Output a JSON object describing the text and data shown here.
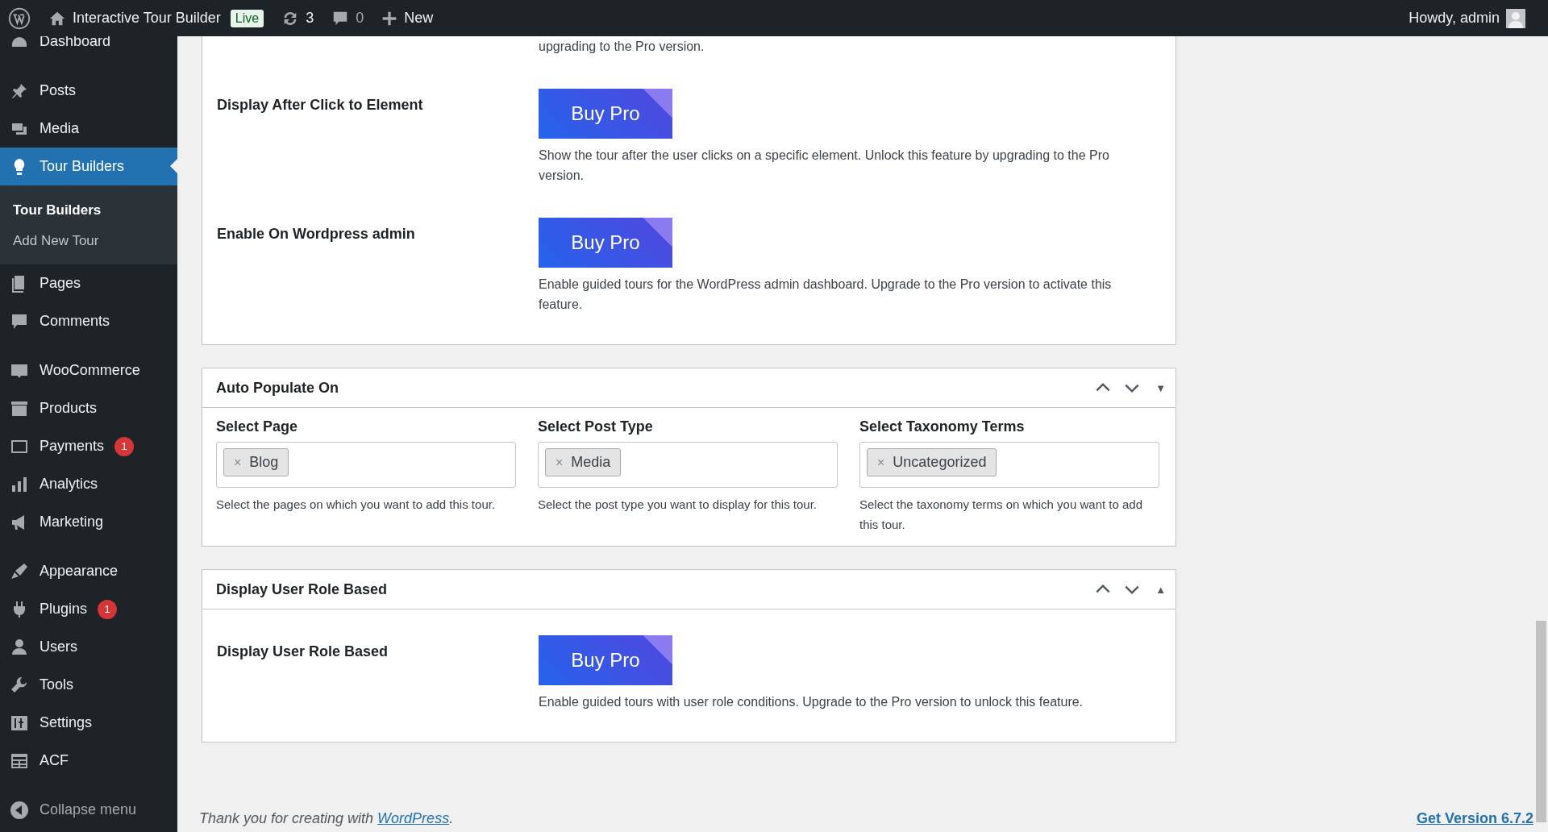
{
  "admin_bar": {
    "site_name": "Interactive Tour Builder",
    "live_badge": "Live",
    "updates_count": "3",
    "comments_count": "0",
    "new_label": "New",
    "greeting": "Howdy, admin"
  },
  "sidebar": {
    "groups": [
      {
        "items": [
          {
            "label": "Dashboard",
            "selected": false
          }
        ]
      },
      {
        "items": [
          {
            "label": "Posts",
            "selected": false
          },
          {
            "label": "Media",
            "selected": false
          },
          {
            "label": "Tour Builders",
            "selected": true,
            "children": [
              {
                "label": "Tour Builders",
                "selected": true
              },
              {
                "label": "Add New Tour",
                "selected": false
              }
            ]
          },
          {
            "label": "Pages",
            "selected": false
          },
          {
            "label": "Comments",
            "selected": false
          }
        ]
      },
      {
        "items": [
          {
            "label": "WooCommerce",
            "selected": false
          },
          {
            "label": "Products",
            "selected": false
          },
          {
            "label": "Payments",
            "selected": false,
            "badge": "1"
          },
          {
            "label": "Analytics",
            "selected": false
          },
          {
            "label": "Marketing",
            "selected": false
          }
        ]
      },
      {
        "items": [
          {
            "label": "Appearance",
            "selected": false
          },
          {
            "label": "Plugins",
            "selected": false,
            "badge": "1"
          },
          {
            "label": "Users",
            "selected": false
          },
          {
            "label": "Tools",
            "selected": false
          },
          {
            "label": "Settings",
            "selected": false
          },
          {
            "label": "ACF",
            "selected": false
          }
        ]
      }
    ],
    "collapse_label": "Collapse menu"
  },
  "cards": [
    {
      "kind": "settings",
      "lead_text": "upgrading to the Pro version.",
      "rows": [
        {
          "label": "Display After Click to Element",
          "button": "Buy Pro",
          "description": "Show the tour after the user clicks on a specific element. Unlock this feature by upgrading to the Pro version."
        },
        {
          "label": "Enable On Wordpress admin",
          "button": "Buy Pro",
          "description": "Enable guided tours for the WordPress admin dashboard. Upgrade to the Pro version to activate this feature."
        }
      ]
    },
    {
      "kind": "fields",
      "title": "Auto Populate On",
      "toggle": "▼",
      "fields": [
        {
          "label": "Select Page",
          "tag": "Blog",
          "remove": "×",
          "help": "Select the pages on which you want to add this tour."
        },
        {
          "label": "Select Post Type",
          "tag": "Media",
          "remove": "×",
          "help": "Select the post type you want to display for this tour."
        },
        {
          "label": "Select Taxonomy Terms",
          "tag": "Uncategorized",
          "remove": "×",
          "help": "Select the taxonomy terms on which you want to add this tour."
        }
      ]
    },
    {
      "kind": "settings",
      "title": "Display User Role Based",
      "toggle": "▲",
      "rows": [
        {
          "label": "Display User Role Based",
          "button": "Buy Pro",
          "description": "Enable guided tours with user role conditions. Upgrade to the Pro version to unlock this feature."
        }
      ]
    }
  ],
  "footer": {
    "credit_before": "Thank you for creating with",
    "credit_link": "WordPress",
    "credit_after": ".",
    "version_link": "Get Version 6.7.2"
  }
}
